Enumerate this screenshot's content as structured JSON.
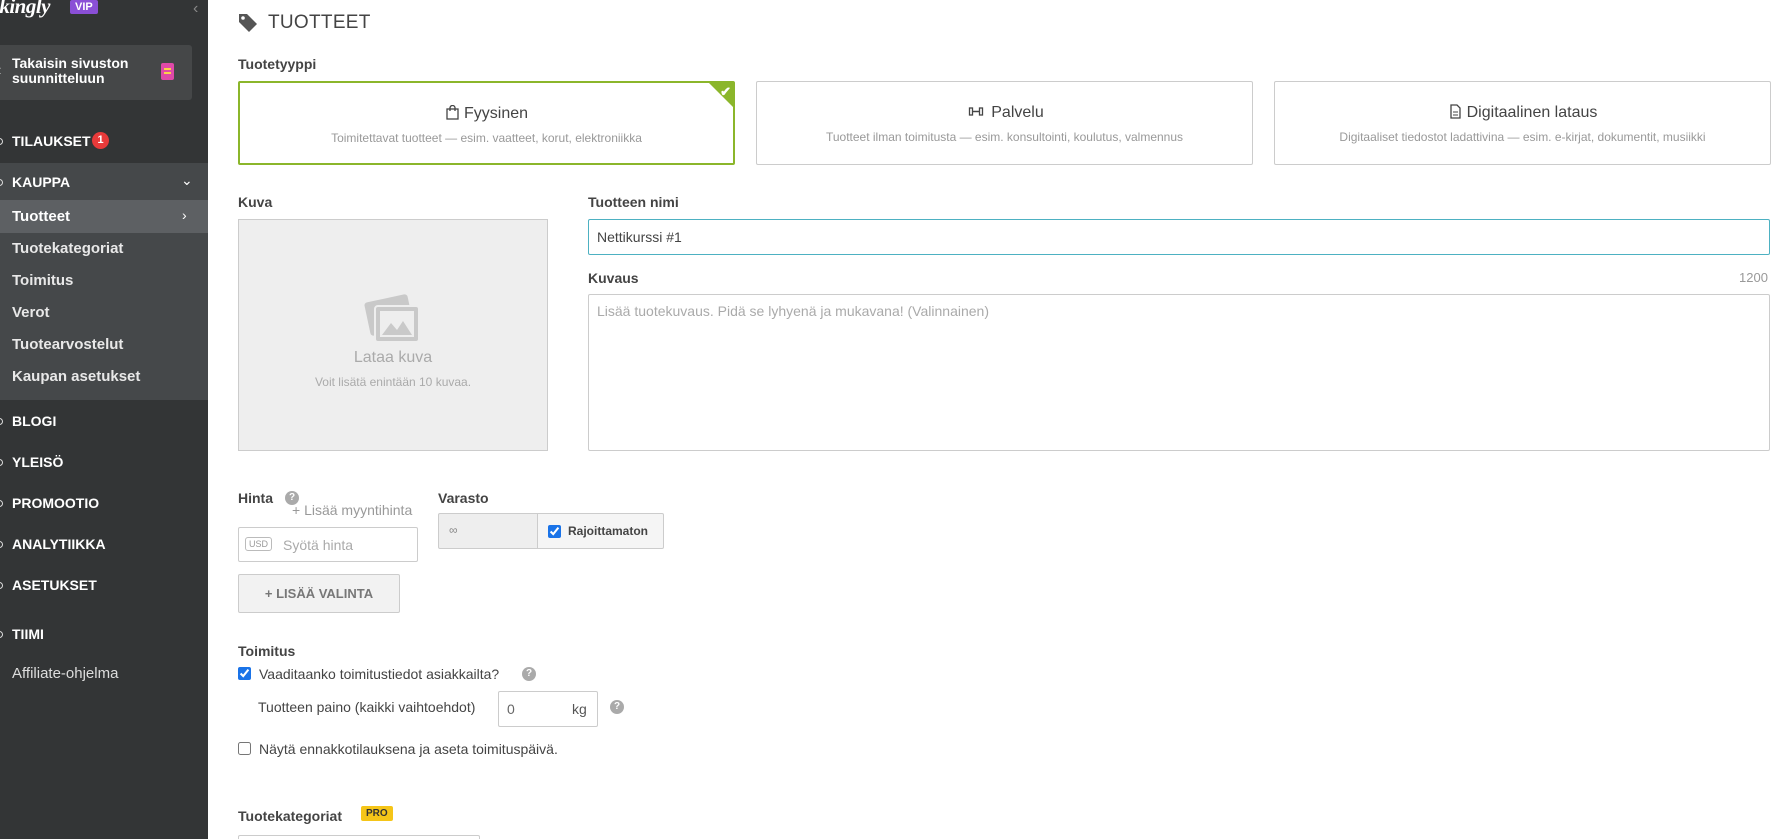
{
  "sidebar": {
    "logo": "ikingly",
    "vip": "VIP",
    "back_label": "Takaisin sivuston suunnitteluun",
    "orders_label": "TILAUKSET",
    "orders_count": "1",
    "shop_label": "KAUPPA",
    "shop_items": [
      "Tuotteet",
      "Tuotekategoriat",
      "Toimitus",
      "Verot",
      "Tuotearvostelut",
      "Kaupan asetukset"
    ],
    "blog_label": "BLOGI",
    "audience_label": "YLEISÖ",
    "promotion_label": "PROMOOTIO",
    "analytics_label": "ANALYTIIKKA",
    "settings_label": "ASETUKSET",
    "team_label": "TIIMI",
    "affiliate_label": "Affiliate-ohjelma"
  },
  "page": {
    "title": "TUOTTEET",
    "product_type_label": "Tuotetyyppi",
    "types": [
      {
        "title": "Fyysinen",
        "desc": "Toimitettavat tuotteet — esim. vaatteet, korut, elektroniikka",
        "selected": true
      },
      {
        "title": "Palvelu",
        "desc": "Tuotteet ilman toimitusta — esim. konsultointi, koulutus, valmennus",
        "selected": false
      },
      {
        "title": "Digitaalinen lataus",
        "desc": "Digitaaliset tiedostot ladattivina — esim. e-kirjat, dokumentit, musiikki",
        "selected": false
      }
    ],
    "image_label": "Kuva",
    "upload_title": "Lataa kuva",
    "upload_hint": "Voit lisätä enintään 10 kuvaa.",
    "name_label": "Tuotteen nimi",
    "name_value": "Nettikurssi #1",
    "desc_label": "Kuvaus",
    "desc_counter": "1200",
    "desc_placeholder": "Lisää tuotekuvaus. Pidä se lyhyenä ja mukavana! (Valinnainen)",
    "price_label": "Hinta",
    "help_glyph": "?",
    "add_sale_price": "+ Lisää myyntihinta",
    "currency": "USD",
    "price_placeholder": "Syötä hinta",
    "add_variant": "+ LISÄÄ VALINTA",
    "stock_label": "Varasto",
    "stock_value": "∞",
    "unlimited_label": "Rajoittamaton",
    "shipping_label": "Toimitus",
    "require_shipping": "Vaaditaanko toimitustiedot asiakkailta?",
    "weight_label": "Tuotteen paino (kaikki vaihtoehdot)",
    "weight_value": "0",
    "weight_unit": "kg",
    "preorder_label": "Näytä ennakkotilauksena ja aseta toimituspäivä.",
    "categories_label": "Tuotekategoriat",
    "pro_badge": "PRO"
  },
  "colors": {
    "sidebar_bg": "#333536",
    "selected_border": "#8bb62b",
    "input_focus": "#4db1c2",
    "badge_red": "#e83a3a",
    "vip_purple": "#8a4fd6",
    "pro_yellow": "#f5c518"
  }
}
